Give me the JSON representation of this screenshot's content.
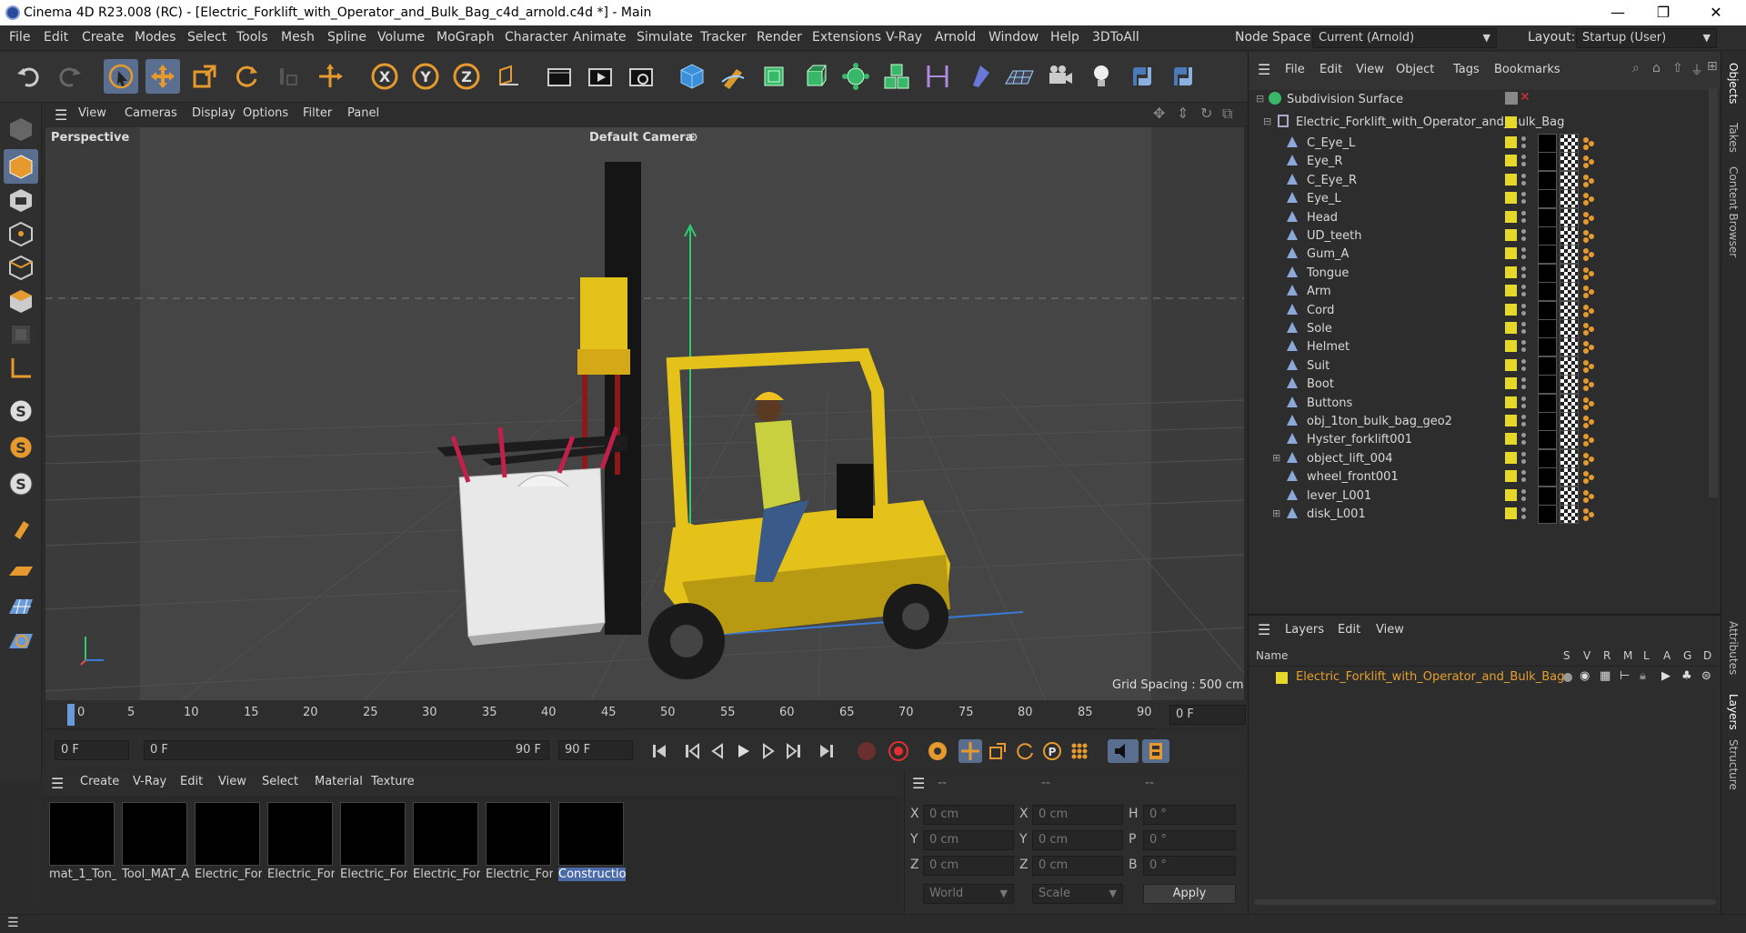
{
  "window": {
    "title": "Cinema 4D R23.008 (RC) - [Electric_Forklift_with_Operator_and_Bulk_Bag_c4d_arnold.c4d *] - Main",
    "min": "—",
    "max": "❐",
    "close": "✕"
  },
  "menubar": {
    "items": [
      "File",
      "Edit",
      "Create",
      "Modes",
      "Select",
      "Tools",
      "Mesh",
      "Spline",
      "Volume",
      "MoGraph",
      "Character",
      "Animate",
      "Simulate",
      "Tracker",
      "Render",
      "Extensions",
      "V-Ray",
      "Arnold",
      "Window",
      "Help",
      "3DToAll"
    ],
    "node_space_label": "Node Space:",
    "node_space_value": "Current (Arnold)",
    "layout_label": "Layout:",
    "layout_value": "Startup (User)"
  },
  "viewport": {
    "menu": [
      "View",
      "Cameras",
      "Display",
      "Options",
      "Filter",
      "Panel"
    ],
    "label": "Perspective",
    "camera": "Default Camera",
    "grid_spacing": "Grid Spacing : 500 cm"
  },
  "timeline": {
    "ticks": [
      "0",
      "5",
      "10",
      "15",
      "20",
      "25",
      "30",
      "35",
      "40",
      "45",
      "50",
      "55",
      "60",
      "65",
      "70",
      "75",
      "80",
      "85",
      "90"
    ],
    "current_frame": "0 F"
  },
  "transport": {
    "start": "0 F",
    "range_start": "0 F",
    "range_end": "90 F",
    "end": "90 F"
  },
  "material_menu": [
    "Create",
    "V-Ray",
    "Edit",
    "View",
    "Select",
    "Material",
    "Texture"
  ],
  "materials": [
    "mat_1_Ton_",
    "Tool_MAT_A",
    "Electric_Forl",
    "Electric_Forl",
    "Electric_Forl",
    "Electric_Forl",
    "Electric_Forl",
    "Constructio"
  ],
  "coords": {
    "headers": [
      "--",
      "--",
      "--"
    ],
    "rows": [
      {
        "a": "X",
        "av": "0 cm",
        "b": "X",
        "bv": "0 cm",
        "c": "H",
        "cv": "0 °"
      },
      {
        "a": "Y",
        "av": "0 cm",
        "b": "Y",
        "bv": "0 cm",
        "c": "P",
        "cv": "0 °"
      },
      {
        "a": "Z",
        "av": "0 cm",
        "b": "Z",
        "bv": "0 cm",
        "c": "B",
        "cv": "0 °"
      }
    ],
    "world": "World",
    "scale": "Scale",
    "apply": "Apply"
  },
  "objects": {
    "menu": [
      "File",
      "Edit",
      "View",
      "Object",
      "Tags",
      "Bookmarks"
    ],
    "root": "Subdivision Surface",
    "group": "Electric_Forklift_with_Operator_and_Bulk_Bag",
    "items": [
      "C_Eye_L",
      "Eye_R",
      "C_Eye_R",
      "Eye_L",
      "Head",
      "UD_teeth",
      "Gum_A",
      "Tongue",
      "Arm",
      "Cord",
      "Sole",
      "Helmet",
      "Suit",
      "Boot",
      "Buttons",
      "obj_1ton_bulk_bag_geo2",
      "Hyster_forklift001",
      "object_lift_004",
      "wheel_front001",
      "lever_L001",
      "disk_L001"
    ]
  },
  "layers": {
    "menu": [
      "Layers",
      "Edit",
      "View"
    ],
    "col_name": "Name",
    "cols": [
      "S",
      "V",
      "R",
      "M",
      "L",
      "A",
      "G",
      "D"
    ],
    "row": "Electric_Forklift_with_Operator_and_Bulk_Bag"
  },
  "right_tabs": [
    "Objects",
    "Takes",
    "Content Browser",
    "Attributes",
    "Layers",
    "Structure"
  ],
  "colors": {
    "accent": "#5a6f8f",
    "layer": "#e6a030",
    "swatch": "#e6d82a"
  }
}
